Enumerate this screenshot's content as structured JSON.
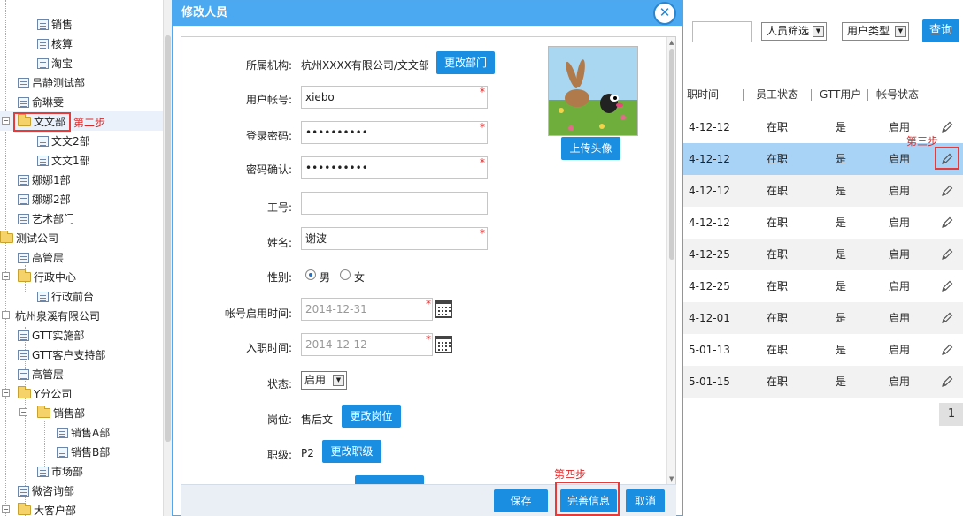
{
  "tree": {
    "items": [
      {
        "label": "销售",
        "type": "file"
      },
      {
        "label": "核算",
        "type": "file"
      },
      {
        "label": "淘宝",
        "type": "file"
      },
      {
        "label": "吕静测试部",
        "type": "file"
      },
      {
        "label": "俞琳雯",
        "type": "file"
      },
      {
        "label": "文文部",
        "type": "folder"
      },
      {
        "label": "文文2部",
        "type": "file"
      },
      {
        "label": "文文1部",
        "type": "file"
      },
      {
        "label": "娜娜1部",
        "type": "file"
      },
      {
        "label": "娜娜2部",
        "type": "file"
      },
      {
        "label": "艺术部门",
        "type": "file"
      },
      {
        "label": "测试公司",
        "type": "folder"
      },
      {
        "label": "高管层",
        "type": "file"
      },
      {
        "label": "行政中心",
        "type": "folder"
      },
      {
        "label": "行政前台",
        "type": "file"
      },
      {
        "label": "杭州泉溪有限公司",
        "type": "folder"
      },
      {
        "label": "GTT实施部",
        "type": "file"
      },
      {
        "label": "GTT客户支持部",
        "type": "file"
      },
      {
        "label": "高管层",
        "type": "file"
      },
      {
        "label": "Y分公司",
        "type": "folder"
      },
      {
        "label": "销售部",
        "type": "folder"
      },
      {
        "label": "销售A部",
        "type": "file"
      },
      {
        "label": "销售B部",
        "type": "file"
      },
      {
        "label": "市场部",
        "type": "file"
      },
      {
        "label": "微咨询部",
        "type": "file"
      },
      {
        "label": "大客户部",
        "type": "folder"
      }
    ],
    "step2_label": "第二步"
  },
  "modal": {
    "title": "修改人员",
    "close_glyph": "✕",
    "fields": {
      "org_label": "所属机构:",
      "org_value": "杭州XXXX有限公司/文文部",
      "change_dept_btn": "更改部门",
      "account_label": "用户帐号:",
      "account_value": "xiebo",
      "password_label": "登录密码:",
      "password_value": "••••••••••",
      "confirm_label": "密码确认:",
      "confirm_value": "••••••••••",
      "jobno_label": "工号:",
      "jobno_value": "",
      "name_label": "姓名:",
      "name_value": "谢波",
      "gender_label": "性别:",
      "gender_male": "男",
      "gender_female": "女",
      "enable_time_label": "帐号启用时间:",
      "enable_time_value": "2014-12-31",
      "join_time_label": "入职时间:",
      "join_time_value": "2014-12-12",
      "status_label": "状态:",
      "status_value": "启用",
      "post_label": "岗位:",
      "post_value": "售后文",
      "change_post_btn": "更改岗位",
      "rank_label": "职级:",
      "rank_value": "P2",
      "change_rank_btn": "更改职级",
      "required_mark": "*"
    },
    "upload_avatar_btn": "上传头像",
    "footer": {
      "save": "保存",
      "complete_info": "完善信息",
      "cancel": "取消",
      "step4_label": "第四步"
    }
  },
  "right": {
    "filter_person": "人员筛选",
    "filter_user_type": "用户类型",
    "query_btn": "查询",
    "columns": [
      "职时间",
      "员工状态",
      "GTT用户",
      "帐号状态"
    ],
    "rows": [
      {
        "date": "4-12-12",
        "status": "在职",
        "gtt": "是",
        "account": "启用"
      },
      {
        "date": "4-12-12",
        "status": "在职",
        "gtt": "是",
        "account": "启用"
      },
      {
        "date": "4-12-12",
        "status": "在职",
        "gtt": "是",
        "account": "启用"
      },
      {
        "date": "4-12-12",
        "status": "在职",
        "gtt": "是",
        "account": "启用"
      },
      {
        "date": "4-12-25",
        "status": "在职",
        "gtt": "是",
        "account": "启用"
      },
      {
        "date": "4-12-25",
        "status": "在职",
        "gtt": "是",
        "account": "启用"
      },
      {
        "date": "4-12-01",
        "status": "在职",
        "gtt": "是",
        "account": "启用"
      },
      {
        "date": "5-01-13",
        "status": "在职",
        "gtt": "是",
        "account": "启用"
      },
      {
        "date": "5-01-15",
        "status": "在职",
        "gtt": "是",
        "account": "启用"
      }
    ],
    "step3_label": "第三步",
    "page": "1"
  },
  "colors": {
    "accent": "#1a8ee0",
    "title_bar": "#4aa9f0",
    "selected_row": "#a8d2f6",
    "step_red": "#e53b3b"
  }
}
